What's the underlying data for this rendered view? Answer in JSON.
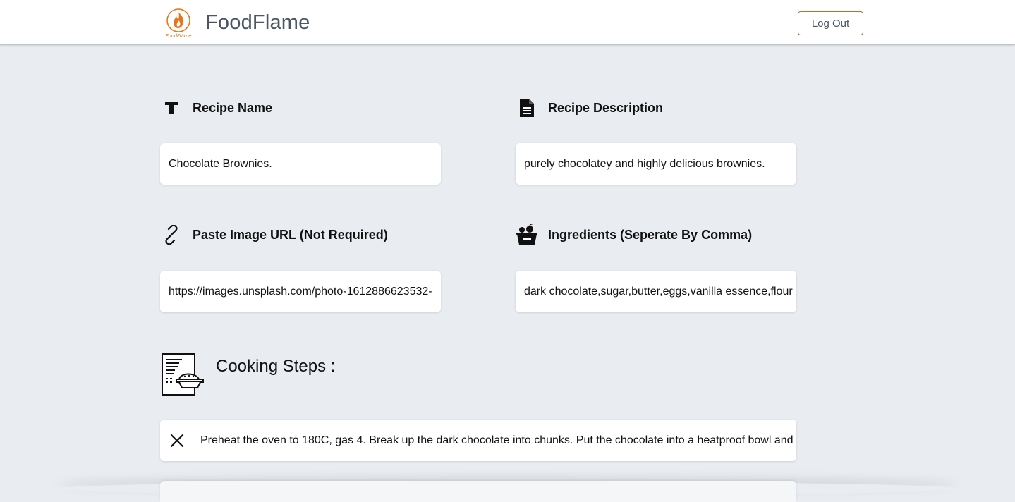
{
  "header": {
    "brand_name": "FoodFlame",
    "logo_caption": "FoodFlame",
    "logout_label": "Log Out"
  },
  "form": {
    "recipe_name": {
      "label": "Recipe Name",
      "icon": "text-icon",
      "value": "Chocolate Brownies."
    },
    "recipe_description": {
      "label": "Recipe Description",
      "icon": "document-icon",
      "value": "purely chocolatey and highly delicious brownies."
    },
    "image_url": {
      "label": "Paste Image URL (Not Required)",
      "icon": "link-icon",
      "value": "https://images.unsplash.com/photo-1612886623532-"
    },
    "ingredients": {
      "label": "Ingredients (Seperate By Comma)",
      "icon": "ingredients-bowl-icon",
      "value": "dark chocolate,sugar,butter,eggs,vanilla essence,flour"
    }
  },
  "steps": {
    "title": "Cooking Steps :",
    "icon": "recipe-steps-icon",
    "items": [
      {
        "text": "Preheat the oven to 180C, gas 4. Break up the dark chocolate into chunks. Put the chocolate into a heatproof bowl and",
        "remove_icon": "close-icon"
      }
    ]
  },
  "colors": {
    "accent": "#e8751a",
    "logout_border": "#c2692c",
    "background": "#e9edf1",
    "brand_text": "#4b5563"
  }
}
